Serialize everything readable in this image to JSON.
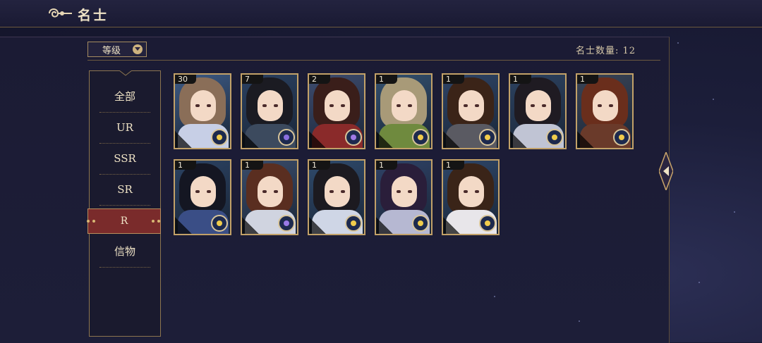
{
  "header": {
    "title": "名士"
  },
  "filter": {
    "label": "等级"
  },
  "count_text": "名士数量: 12",
  "sidebar": {
    "items": [
      {
        "label": "全部"
      },
      {
        "label": "UR"
      },
      {
        "label": "SSR"
      },
      {
        "label": "SR"
      },
      {
        "label": "R"
      },
      {
        "label": "信物"
      }
    ],
    "active": "R"
  },
  "cards": [
    {
      "level": "30",
      "hair": "#8a6e58",
      "body": "#c7cfe6",
      "bg": "#3d5a84",
      "orb": "#f0cc4c"
    },
    {
      "level": "7",
      "hair": "#1b1b22",
      "body": "#3c4a5e",
      "bg": "#2a4060",
      "orb": "#8a6fe0"
    },
    {
      "level": "2",
      "hair": "#3a1e1a",
      "body": "#8a2a2a",
      "bg": "#3e4c6e",
      "orb": "#a07ae6"
    },
    {
      "level": "1",
      "hair": "#a89a78",
      "body": "#6f8a3e",
      "bg": "#33506e",
      "orb": "#f0cc4c"
    },
    {
      "level": "1",
      "hair": "#3b2418",
      "body": "#5a5a62",
      "bg": "#2e4466",
      "orb": "#f0cc4c"
    },
    {
      "level": "1",
      "hair": "#1f1b22",
      "body": "#c0c4d4",
      "bg": "#2c4260",
      "orb": "#f0cc4c"
    },
    {
      "level": "1",
      "hair": "#6a2e1c",
      "body": "#6a3a2a",
      "bg": "#3a4456",
      "orb": "#f0cc4c"
    },
    {
      "level": "1",
      "hair": "#141622",
      "body": "#3a4e86",
      "bg": "#2b4262",
      "orb": "#f0cc4c"
    },
    {
      "level": "1",
      "hair": "#5a2e20",
      "body": "#d0d4e0",
      "bg": "#3a4c6a",
      "orb": "#9a7ae6"
    },
    {
      "level": "1",
      "hair": "#1c1a20",
      "body": "#cfd6e6",
      "bg": "#2f4a6c",
      "orb": "#f0cc4c"
    },
    {
      "level": "1",
      "hair": "#2a1e3a",
      "body": "#b6b8d2",
      "bg": "#2f4266",
      "orb": "#f0cc4c"
    },
    {
      "level": "1",
      "hair": "#3a2418",
      "body": "#e8e6ea",
      "bg": "#2e4668",
      "orb": "#f0cc4c"
    }
  ],
  "colors": {
    "accent_gold": "#c2a168",
    "active_red": "#7a2b2b"
  },
  "icons": {
    "logo": "cloud-swirl-icon",
    "dropdown": "chevron-down-icon",
    "expand": "arrow-left-icon",
    "orb": "star-orb-icon"
  }
}
